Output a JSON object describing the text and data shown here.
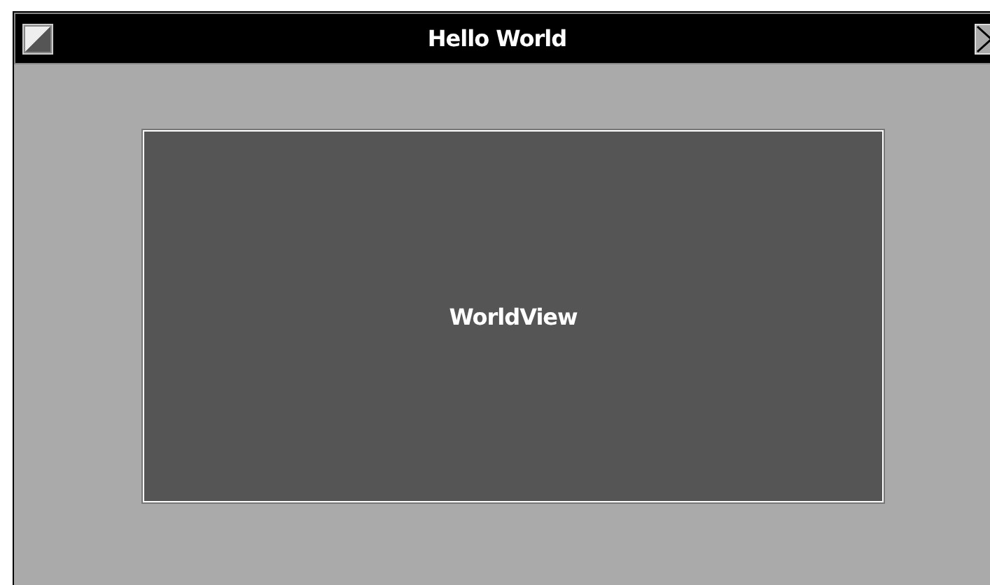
{
  "window": {
    "title": "Hello World"
  },
  "view": {
    "label": "WorldView"
  }
}
